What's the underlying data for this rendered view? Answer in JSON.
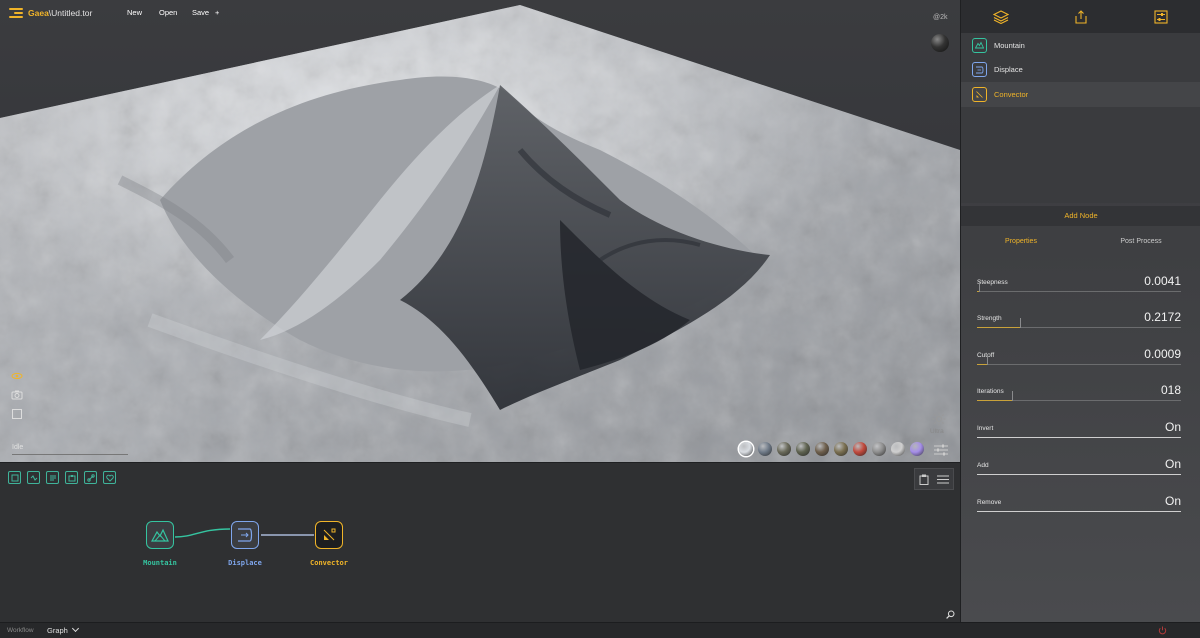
{
  "app": {
    "brand": "Gaea",
    "separator": "\\",
    "file": "Untitled.tor"
  },
  "toolbar": {
    "new_label": "New",
    "open_label": "Open",
    "save_label": "Save",
    "plus_label": "+"
  },
  "viewport": {
    "resolution": "@2k",
    "status": "Idle",
    "quality": "Ultra",
    "swatches": [
      "#d9dde2",
      "#6f7a88",
      "#6a6a5a",
      "#5f6350",
      "#6e5f4c",
      "#7a6f50",
      "#c2493c",
      "#8e8e8e",
      "#cfcfcf",
      "#a58ee8"
    ]
  },
  "graph": {
    "nodes": [
      {
        "name": "Mountain",
        "color": "#35c4a0"
      },
      {
        "name": "Displace",
        "color": "#7fa6ec"
      },
      {
        "name": "Convector",
        "color": "#f0b429"
      }
    ]
  },
  "bottombar": {
    "workflow_label": "Workflow",
    "mode": "Graph"
  },
  "rightpanel": {
    "node_list": [
      {
        "name": "Mountain",
        "color": "#35c4a0"
      },
      {
        "name": "Displace",
        "color": "#7fa6ec"
      },
      {
        "name": "Convector",
        "color": "#f0b429"
      }
    ],
    "add_node": "Add Node",
    "tabs": [
      "Properties",
      "Post Process"
    ],
    "properties": [
      {
        "name": "Steepness",
        "value": "0.0041",
        "fraction": 0.01
      },
      {
        "name": "Strength",
        "value": "0.2172",
        "fraction": 0.21
      },
      {
        "name": "Cutoff",
        "value": "0.0009",
        "fraction": 0.05
      },
      {
        "name": "Iterations",
        "value": "018",
        "fraction": 0.17
      }
    ],
    "toggles": [
      {
        "name": "Invert",
        "value": "On"
      },
      {
        "name": "Add",
        "value": "On"
      },
      {
        "name": "Remove",
        "value": "On"
      }
    ]
  }
}
